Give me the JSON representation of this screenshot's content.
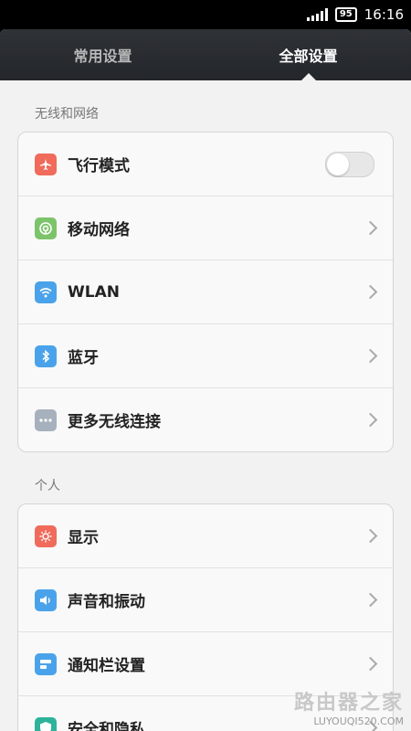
{
  "status_bar": {
    "battery": "95",
    "time": "16:16"
  },
  "tabs": [
    {
      "label": "常用设置",
      "active": false
    },
    {
      "label": "全部设置",
      "active": true
    }
  ],
  "sections": [
    {
      "title": "无线和网络",
      "items": [
        {
          "label": "飞行模式",
          "icon": "airplane-icon",
          "icon_color": "#f06b5b",
          "control": "toggle",
          "toggle_on": false
        },
        {
          "label": "移动网络",
          "icon": "mobile-network-icon",
          "icon_color": "#7cc46a",
          "control": "chevron"
        },
        {
          "label": "WLAN",
          "icon": "wifi-icon",
          "icon_color": "#4aa3ea",
          "control": "chevron"
        },
        {
          "label": "蓝牙",
          "icon": "bluetooth-icon",
          "icon_color": "#4aa3ea",
          "control": "chevron"
        },
        {
          "label": "更多无线连接",
          "icon": "more-icon",
          "icon_color": "#a7b1bd",
          "control": "chevron"
        }
      ]
    },
    {
      "title": "个人",
      "items": [
        {
          "label": "显示",
          "icon": "display-icon",
          "icon_color": "#f06b5b",
          "control": "chevron"
        },
        {
          "label": "声音和振动",
          "icon": "sound-icon",
          "icon_color": "#4aa3ea",
          "control": "chevron"
        },
        {
          "label": "通知栏设置",
          "icon": "notification-bar-icon",
          "icon_color": "#4aa3ea",
          "control": "chevron"
        },
        {
          "label": "安全和隐私",
          "icon": "security-icon",
          "icon_color": "#2db39a",
          "control": "chevron"
        }
      ]
    }
  ],
  "watermark": {
    "text": "路由器之家",
    "site": "LUYOUQI520.COM"
  }
}
